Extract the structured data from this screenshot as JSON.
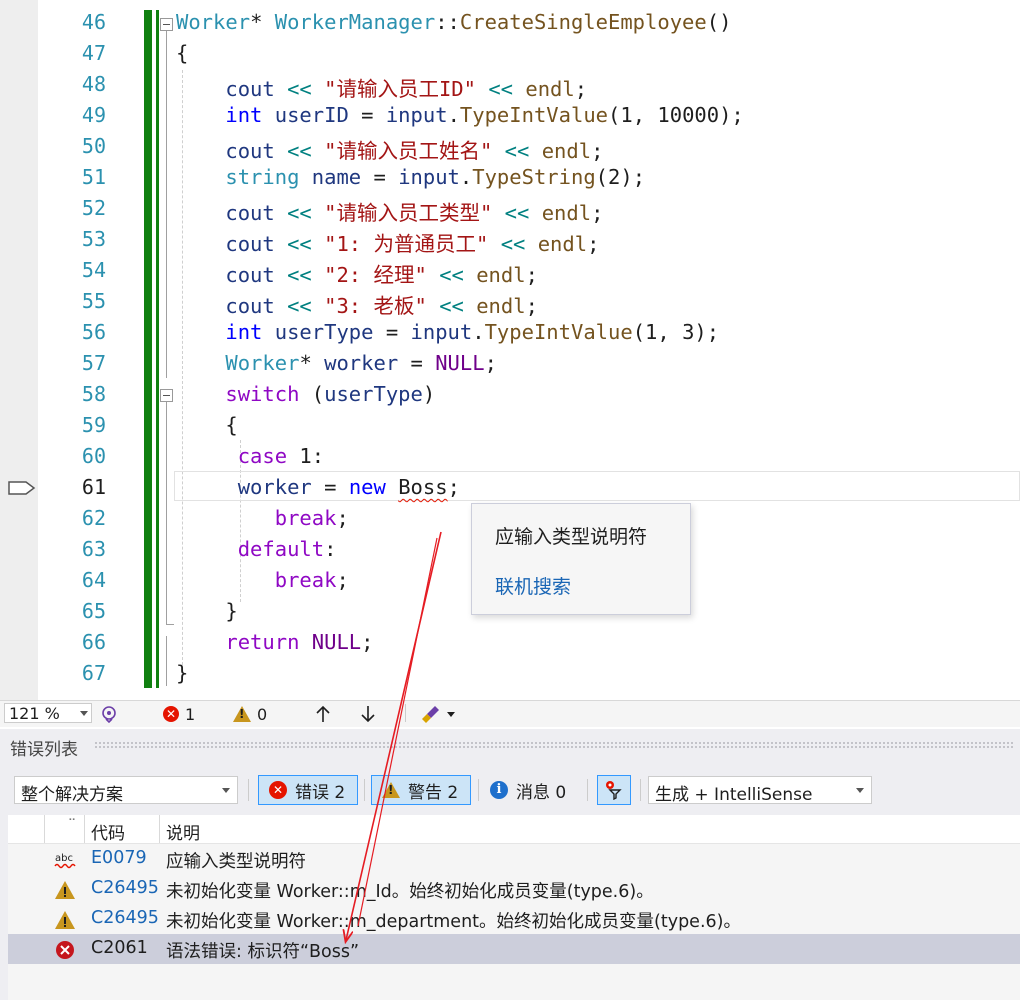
{
  "editor": {
    "lines": [
      {
        "n": "46",
        "tokens": [
          [
            "tk-type",
            "Worker"
          ],
          [
            "tk-plain",
            "* "
          ],
          [
            "tk-type",
            "WorkerManager"
          ],
          [
            "tk-plain",
            "::"
          ],
          [
            "tk-fn",
            "CreateSingleEmployee"
          ],
          [
            "tk-plain",
            "()"
          ]
        ]
      },
      {
        "n": "47",
        "tokens": [
          [
            "tk-plain",
            "{"
          ]
        ]
      },
      {
        "n": "48",
        "tokens": [
          [
            "tk-plain",
            "    "
          ],
          [
            "tk-id",
            "cout"
          ],
          [
            "tk-plain",
            " "
          ],
          [
            "tk-op",
            "<<"
          ],
          [
            "tk-plain",
            " "
          ],
          [
            "tk-str",
            "\"请输入员工ID\""
          ],
          [
            "tk-plain",
            " "
          ],
          [
            "tk-op",
            "<<"
          ],
          [
            "tk-plain",
            " "
          ],
          [
            "tk-fn",
            "endl"
          ],
          [
            "tk-plain",
            ";"
          ]
        ]
      },
      {
        "n": "49",
        "tokens": [
          [
            "tk-plain",
            "    "
          ],
          [
            "tk-kw",
            "int"
          ],
          [
            "tk-plain",
            " "
          ],
          [
            "tk-id",
            "userID"
          ],
          [
            "tk-plain",
            " = "
          ],
          [
            "tk-id",
            "input"
          ],
          [
            "tk-plain",
            "."
          ],
          [
            "tk-fn",
            "TypeIntValue"
          ],
          [
            "tk-plain",
            "(1, 10000);"
          ]
        ]
      },
      {
        "n": "50",
        "tokens": [
          [
            "tk-plain",
            "    "
          ],
          [
            "tk-id",
            "cout"
          ],
          [
            "tk-plain",
            " "
          ],
          [
            "tk-op",
            "<<"
          ],
          [
            "tk-plain",
            " "
          ],
          [
            "tk-str",
            "\"请输入员工姓名\""
          ],
          [
            "tk-plain",
            " "
          ],
          [
            "tk-op",
            "<<"
          ],
          [
            "tk-plain",
            " "
          ],
          [
            "tk-fn",
            "endl"
          ],
          [
            "tk-plain",
            ";"
          ]
        ]
      },
      {
        "n": "51",
        "tokens": [
          [
            "tk-plain",
            "    "
          ],
          [
            "tk-type",
            "string"
          ],
          [
            "tk-plain",
            " "
          ],
          [
            "tk-id",
            "name"
          ],
          [
            "tk-plain",
            " = "
          ],
          [
            "tk-id",
            "input"
          ],
          [
            "tk-plain",
            "."
          ],
          [
            "tk-fn",
            "TypeString"
          ],
          [
            "tk-plain",
            "(2);"
          ]
        ]
      },
      {
        "n": "52",
        "tokens": [
          [
            "tk-plain",
            "    "
          ],
          [
            "tk-id",
            "cout"
          ],
          [
            "tk-plain",
            " "
          ],
          [
            "tk-op",
            "<<"
          ],
          [
            "tk-plain",
            " "
          ],
          [
            "tk-str",
            "\"请输入员工类型\""
          ],
          [
            "tk-plain",
            " "
          ],
          [
            "tk-op",
            "<<"
          ],
          [
            "tk-plain",
            " "
          ],
          [
            "tk-fn",
            "endl"
          ],
          [
            "tk-plain",
            ";"
          ]
        ]
      },
      {
        "n": "53",
        "tokens": [
          [
            "tk-plain",
            "    "
          ],
          [
            "tk-id",
            "cout"
          ],
          [
            "tk-plain",
            " "
          ],
          [
            "tk-op",
            "<<"
          ],
          [
            "tk-plain",
            " "
          ],
          [
            "tk-str",
            "\"1: 为普通员工\""
          ],
          [
            "tk-plain",
            " "
          ],
          [
            "tk-op",
            "<<"
          ],
          [
            "tk-plain",
            " "
          ],
          [
            "tk-fn",
            "endl"
          ],
          [
            "tk-plain",
            ";"
          ]
        ]
      },
      {
        "n": "54",
        "tokens": [
          [
            "tk-plain",
            "    "
          ],
          [
            "tk-id",
            "cout"
          ],
          [
            "tk-plain",
            " "
          ],
          [
            "tk-op",
            "<<"
          ],
          [
            "tk-plain",
            " "
          ],
          [
            "tk-str",
            "\"2: 经理\""
          ],
          [
            "tk-plain",
            " "
          ],
          [
            "tk-op",
            "<<"
          ],
          [
            "tk-plain",
            " "
          ],
          [
            "tk-fn",
            "endl"
          ],
          [
            "tk-plain",
            ";"
          ]
        ]
      },
      {
        "n": "55",
        "tokens": [
          [
            "tk-plain",
            "    "
          ],
          [
            "tk-id",
            "cout"
          ],
          [
            "tk-plain",
            " "
          ],
          [
            "tk-op",
            "<<"
          ],
          [
            "tk-plain",
            " "
          ],
          [
            "tk-str",
            "\"3: 老板\""
          ],
          [
            "tk-plain",
            " "
          ],
          [
            "tk-op",
            "<<"
          ],
          [
            "tk-plain",
            " "
          ],
          [
            "tk-fn",
            "endl"
          ],
          [
            "tk-plain",
            ";"
          ]
        ]
      },
      {
        "n": "56",
        "tokens": [
          [
            "tk-plain",
            "    "
          ],
          [
            "tk-kw",
            "int"
          ],
          [
            "tk-plain",
            " "
          ],
          [
            "tk-id",
            "userType"
          ],
          [
            "tk-plain",
            " = "
          ],
          [
            "tk-id",
            "input"
          ],
          [
            "tk-plain",
            "."
          ],
          [
            "tk-fn",
            "TypeIntValue"
          ],
          [
            "tk-plain",
            "(1, 3);"
          ]
        ]
      },
      {
        "n": "57",
        "tokens": [
          [
            "tk-plain",
            "    "
          ],
          [
            "tk-type",
            "Worker"
          ],
          [
            "tk-plain",
            "* "
          ],
          [
            "tk-id",
            "worker"
          ],
          [
            "tk-plain",
            " = "
          ],
          [
            "tk-mac",
            "NULL"
          ],
          [
            "tk-plain",
            ";"
          ]
        ]
      },
      {
        "n": "58",
        "tokens": [
          [
            "tk-plain",
            "    "
          ],
          [
            "tk-ctl",
            "switch"
          ],
          [
            "tk-plain",
            " ("
          ],
          [
            "tk-id",
            "userType"
          ],
          [
            "tk-plain",
            ")"
          ]
        ]
      },
      {
        "n": "59",
        "tokens": [
          [
            "tk-plain",
            "    {"
          ]
        ]
      },
      {
        "n": "60",
        "tokens": [
          [
            "tk-plain",
            "     "
          ],
          [
            "tk-ctl",
            "case"
          ],
          [
            "tk-plain",
            " 1:"
          ]
        ]
      },
      {
        "n": "61",
        "tokens": [
          [
            "tk-plain",
            "     "
          ],
          [
            "tk-id",
            "worker"
          ],
          [
            "tk-plain",
            " = "
          ],
          [
            "tk-kw",
            "new"
          ],
          [
            "tk-plain",
            " "
          ],
          [
            "tk-plain squiggle",
            "Boss"
          ],
          [
            "tk-plain",
            ";"
          ]
        ]
      },
      {
        "n": "62",
        "tokens": [
          [
            "tk-plain",
            "        "
          ],
          [
            "tk-ctl",
            "break"
          ],
          [
            "tk-plain",
            ";"
          ]
        ]
      },
      {
        "n": "63",
        "tokens": [
          [
            "tk-plain",
            "     "
          ],
          [
            "tk-ctl",
            "default"
          ],
          [
            "tk-plain",
            ":"
          ]
        ]
      },
      {
        "n": "64",
        "tokens": [
          [
            "tk-plain",
            "        "
          ],
          [
            "tk-ctl",
            "break"
          ],
          [
            "tk-plain",
            ";"
          ]
        ]
      },
      {
        "n": "65",
        "tokens": [
          [
            "tk-plain",
            "    }"
          ]
        ]
      },
      {
        "n": "66",
        "tokens": [
          [
            "tk-plain",
            "    "
          ],
          [
            "tk-ctl",
            "return"
          ],
          [
            "tk-plain",
            " "
          ],
          [
            "tk-mac",
            "NULL"
          ],
          [
            "tk-plain",
            ";"
          ]
        ]
      },
      {
        "n": "67",
        "tokens": [
          [
            "tk-plain",
            "}"
          ]
        ]
      }
    ],
    "current_line": "61",
    "tooltip": {
      "message": "应输入类型说明符",
      "search_link": "联机搜索"
    }
  },
  "editor_status": {
    "zoom": "121 %",
    "errors": "1",
    "warnings": "0"
  },
  "error_list": {
    "title": "错误列表",
    "scope": "整个解决方案",
    "errors_toggle": "错误 2",
    "warnings_toggle": "警告 2",
    "messages_toggle": "消息 0",
    "source": "生成 + IntelliSense",
    "columns": {
      "code": "代码",
      "description": "说明"
    },
    "rows": [
      {
        "kind": "intellisense",
        "code": "E0079",
        "desc": "应输入类型说明符",
        "selected": false
      },
      {
        "kind": "warning",
        "code": "C26495",
        "desc": "未初始化变量 Worker::m_Id。始终初始化成员变量(type.6)。",
        "selected": false
      },
      {
        "kind": "warning",
        "code": "C26495",
        "desc": "未初始化变量 Worker::m_department。始终初始化成员变量(type.6)。",
        "selected": false
      },
      {
        "kind": "error",
        "code": "C2061",
        "desc": "语法错误: 标识符“Boss”",
        "selected": true
      }
    ]
  },
  "colors": {
    "accent": "#3399ff",
    "error": "#e51400",
    "warning": "#c8961e",
    "change_bar": "#108010",
    "annotation_arrow": "#e51c23"
  },
  "icons": [
    "breakpoint-arrow-icon",
    "fold-icon",
    "intellicode-icon",
    "error-icon",
    "warning-icon",
    "arrow-up-icon",
    "arrow-down-icon",
    "cleanup-brush-icon",
    "info-icon",
    "filter-icon",
    "spellcheck-icon"
  ]
}
